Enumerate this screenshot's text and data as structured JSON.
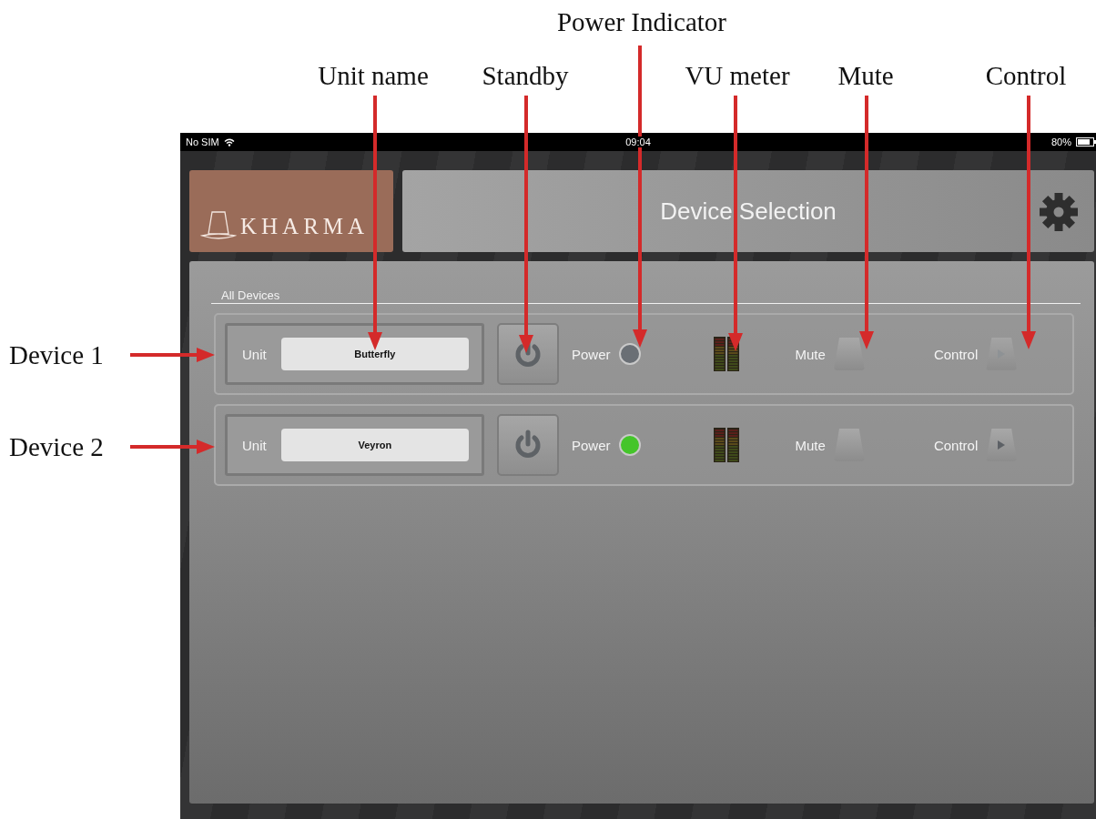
{
  "annotations": {
    "callouts": [
      "Power Indicator",
      "Unit name",
      "Standby",
      "VU meter",
      "Mute",
      "Control"
    ],
    "device_labels": [
      "Device  1",
      "Device  2"
    ]
  },
  "status_bar": {
    "carrier": "No SIM",
    "time": "09:04",
    "battery": "80%"
  },
  "header": {
    "logo": "KHARMA",
    "title": "Device Selection"
  },
  "section": {
    "title": "All Devices"
  },
  "devices": [
    {
      "unit_label": "Unit",
      "name": "Butterfly",
      "power_label": "Power",
      "power": false,
      "mute_label": "Mute",
      "control_label": "Control",
      "control_enabled": false
    },
    {
      "unit_label": "Unit",
      "name": "Veyron",
      "power_label": "Power",
      "power": true,
      "mute_label": "Mute",
      "control_label": "Control",
      "control_enabled": true
    }
  ]
}
